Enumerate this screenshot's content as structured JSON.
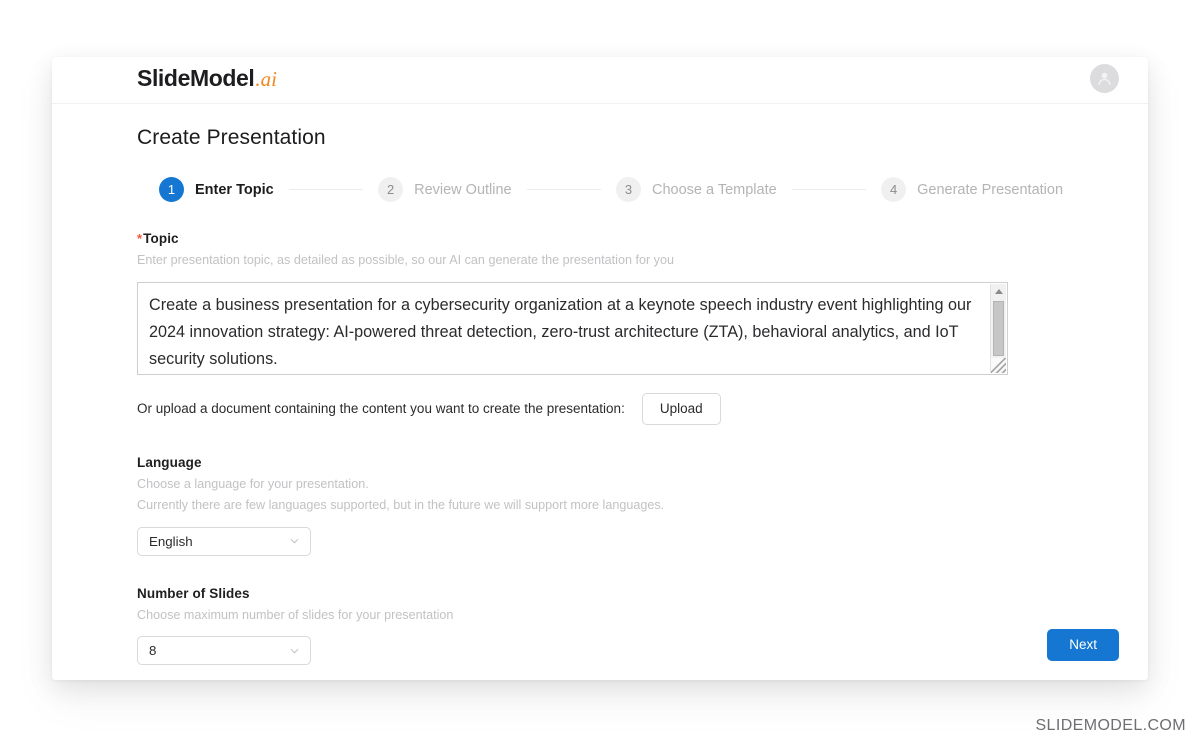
{
  "header": {
    "logo_main": "SlideModel",
    "logo_suffix": ".ai",
    "avatar_icon": "user-avatar-icon"
  },
  "page_title": "Create Presentation",
  "stepper": {
    "steps": [
      {
        "number": "1",
        "label": "Enter Topic",
        "active": true
      },
      {
        "number": "2",
        "label": "Review Outline",
        "active": false
      },
      {
        "number": "3",
        "label": "Choose a Template",
        "active": false
      },
      {
        "number": "4",
        "label": "Generate Presentation",
        "active": false
      }
    ]
  },
  "topic": {
    "required_mark": "*",
    "label": "Topic",
    "hint": "Enter presentation topic, as detailed as possible, so our AI can generate the presentation for you",
    "value": "Create a business presentation for a cybersecurity organization at a keynote speech industry event highlighting our 2024 innovation strategy: AI-powered threat detection, zero-trust architecture (ZTA), behavioral analytics, and IoT security solutions.",
    "scrollbar": {
      "up_icon": "scroll-up-arrow-icon",
      "down_icon": "scroll-down-arrow-icon",
      "resize_icon": "resize-grip-icon"
    }
  },
  "upload": {
    "text": "Or upload a document containing the content you want to create the presentation:",
    "button_label": "Upload"
  },
  "language": {
    "label": "Language",
    "hint_line1": "Choose a language for your presentation.",
    "hint_line2": "Currently there are few languages supported, but in the future we will support more languages.",
    "selected": "English",
    "chevron_icon": "chevron-down-icon"
  },
  "slides": {
    "label": "Number of Slides",
    "hint": "Choose maximum number of slides for your presentation",
    "selected": "8",
    "chevron_icon": "chevron-down-icon"
  },
  "footer": {
    "next_label": "Next",
    "watermark": "SLIDEMODEL.COM"
  },
  "colors": {
    "accent_blue": "#1677d2",
    "logo_orange": "#f1871f",
    "required_red": "#f5533d"
  }
}
